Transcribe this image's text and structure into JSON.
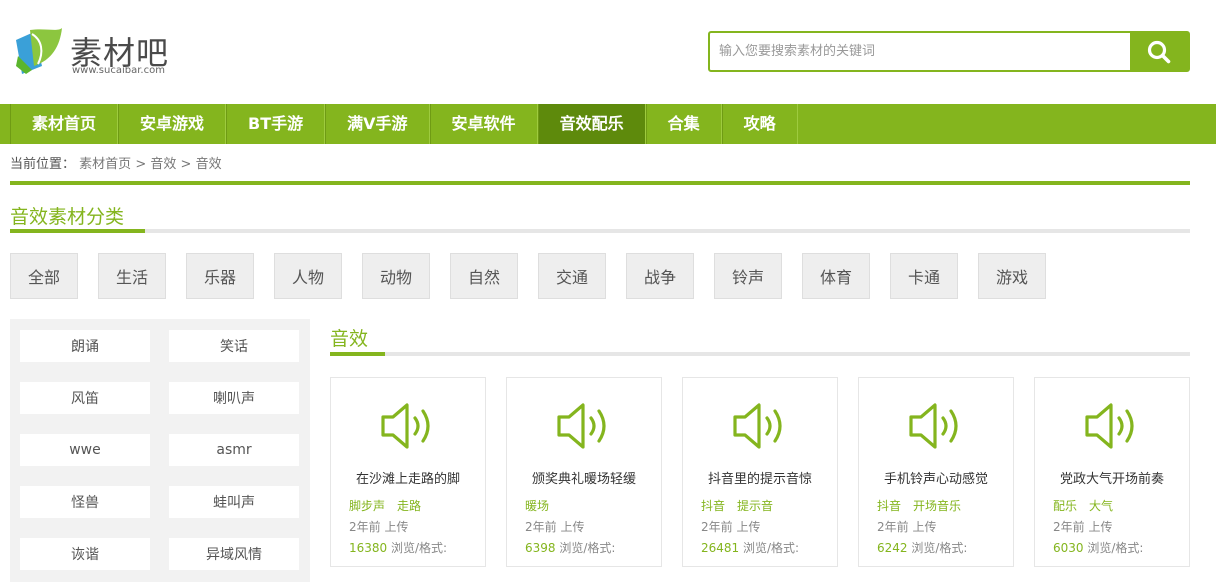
{
  "brand": {
    "name": "素材吧",
    "url": "www.sucaibar.com",
    "accent": "#84b51e"
  },
  "search": {
    "placeholder": "输入您要搜索素材的关键词",
    "icon": "search-icon"
  },
  "nav": {
    "items": [
      "素材首页",
      "安卓游戏",
      "BT手游",
      "满V手游",
      "安卓软件",
      "音效配乐",
      "合集",
      "攻略"
    ],
    "active_index": 5
  },
  "breadcrumb": {
    "prefix": "当前位置：",
    "items": [
      "素材首页",
      "音效",
      "音效"
    ],
    "separator": ">"
  },
  "category_section": {
    "title": "音效素材分类",
    "categories": [
      "全部",
      "生活",
      "乐器",
      "人物",
      "动物",
      "自然",
      "交通",
      "战争",
      "铃声",
      "体育",
      "卡通",
      "游戏"
    ]
  },
  "sidebar": {
    "tags": [
      "朗诵",
      "笑话",
      "风笛",
      "喇叭声",
      "wwe",
      "asmr",
      "怪兽",
      "蛙叫声",
      "诙谐",
      "异域风情"
    ]
  },
  "main": {
    "title": "音效",
    "cards": [
      {
        "title": "在沙滩上走路的脚",
        "tags": [
          "脚步声",
          "走路"
        ],
        "date": "2年前 上传",
        "views": "16380",
        "views_suffix": "浏览/格式:"
      },
      {
        "title": "颁奖典礼暖场轻缓",
        "tags": [
          "暖场"
        ],
        "date": "2年前 上传",
        "views": "6398",
        "views_suffix": "浏览/格式:"
      },
      {
        "title": "抖音里的提示音惊",
        "tags": [
          "抖音",
          "提示音"
        ],
        "date": "2年前 上传",
        "views": "26481",
        "views_suffix": "浏览/格式:"
      },
      {
        "title": "手机铃声心动感觉",
        "tags": [
          "抖音",
          "开场音乐"
        ],
        "date": "2年前 上传",
        "views": "6242",
        "views_suffix": "浏览/格式:"
      },
      {
        "title": "党政大气开场前奏",
        "tags": [
          "配乐",
          "大气"
        ],
        "date": "2年前 上传",
        "views": "6030",
        "views_suffix": "浏览/格式:"
      }
    ]
  }
}
